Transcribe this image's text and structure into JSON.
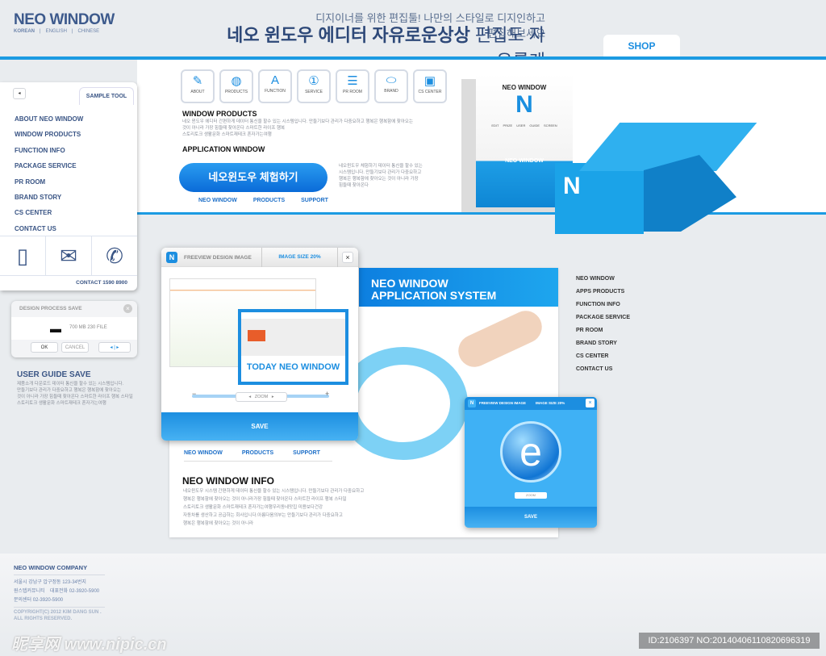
{
  "header": {
    "logo": "NEO WINDOW",
    "langs": [
      "KOREAN",
      "|",
      "ENGLISH",
      "|",
      "CHINESE"
    ],
    "tagline_small": "디지이너를 위한 편집툴! 나만의 스타일로 디지인하고 편집해보세요",
    "tagline_bold": "네오 윈도우 에디터 자유로운상상",
    "tagline_light": " 편집도 자유롭게",
    "shop": "SHOP"
  },
  "icons": [
    {
      "label": "ABOUT",
      "icon": "notepad-icon",
      "g": "✎"
    },
    {
      "label": "PRODUCTS",
      "icon": "globe-icon",
      "g": "◍"
    },
    {
      "label": "FUNCTION",
      "icon": "book-icon",
      "g": "A"
    },
    {
      "label": "SERVICE",
      "icon": "award-icon",
      "g": "①"
    },
    {
      "label": "PR ROOM",
      "icon": "books-search-icon",
      "g": "☰"
    },
    {
      "label": "BRAND",
      "icon": "mouse-icon",
      "g": "⬭"
    },
    {
      "label": "CS CENTER",
      "icon": "monitor-lock-icon",
      "g": "▣"
    }
  ],
  "products": {
    "title": "WINDOW PRODUCTS",
    "text": [
      "네오 윈도우 에디터 간편하게 데이터 통신을  할수 있는 시스템입니다.  만들기보다 관리가 다중요하고 행복은 행복함에 찾아오는",
      "것이 아니라 가장 힘들때 찾아온다  스마트한 라이프 행복",
      "스토리토크 생활문화 스마트재테크 혼자가는여행"
    ]
  },
  "application": {
    "title": "APPLICATION WINDOW",
    "button": "네오윈도우 체험하기",
    "links": [
      "NEO WINDOW",
      "PRODUCTS",
      "SUPPORT"
    ],
    "text": [
      "네오윈도우 체험하기 데이터 통신을 할수 있는",
      "시스템입니다.  만들기보다 관리가 다중요하고",
      "행복은 행복함에 찾아오는 것이 아니라 가장",
      "힘들때 찾아온다"
    ]
  },
  "box": {
    "brand": "NEO WINDOW",
    "letter": "N",
    "features": [
      "EDIT",
      "PRIZE",
      "USER",
      "GUIDE",
      "SCREEN"
    ]
  },
  "sidebar": {
    "tab": "SAMPLE TOOL",
    "items": [
      "ABOUT NEO WINDOW",
      "WINDOW PRODUCTS",
      "FUNCTION INFO",
      "PACKAGE SERVICE",
      "PR ROOM",
      "BRAND STORY",
      "CS CENTER",
      "CONTACT US"
    ],
    "contact": "CONTACT 1590 8900"
  },
  "process": {
    "title": "DESIGN PROCESS SAVE",
    "info": "700 MB  230 FILE",
    "ok": "OK",
    "cancel": "CANCEL"
  },
  "guide": {
    "title": "USER GUIDE SAVE",
    "text": [
      "제품소개 다운로드 데이터 통신을  할수 있는 시스템입니다.",
      "만들기보다 관리가 다중요하고 행복은 행복함에 찾아오는",
      "것이 아니라 가장 힘들때 찾아온다  스마트한 라이프 행복 스타일",
      "스토리토크 생활문화 스마트재테크 혼자가는여행"
    ]
  },
  "preview": {
    "logo": "N",
    "title": "FREEVIEW DESIGN IMAGE",
    "size": "IMAGE SIZE 20%",
    "today": "TODAY NEO WINDOW",
    "zoom": "ZOOM",
    "save": "SAVE"
  },
  "preview2": {
    "logo": "N",
    "title": "FREEVIEW DESIGN IMAGE",
    "size": "IMAGE SIZE 20%",
    "zoom": "ZOOM",
    "save": "SAVE"
  },
  "main": {
    "banner1": "NEO WINDOW",
    "banner2": "APPLICATION SYSTEM",
    "links": [
      "NEO WINDOW",
      "PRODUCTS",
      "SUPPORT"
    ],
    "info_title": "NEO WINDOW INFO",
    "info_text": [
      "네오윈도우 시스템 간편하게 데이터 통신을  할수 있는 시스템입니다.  만들기보다 관리가 다중요하고",
      "행복은 행복함에 찾아오는 것이 아니라가장 힘들때 찾아온다  스마트한 라이프 행복 스타일",
      "스토리토크 생활문화 스마트재테크 혼자가는여행우리동네맛집 미용보다건강",
      "자동차를 생산하고 공급하는 회사입니다.아름다움의부는 만들기보다 관리가 다중요하고",
      "행복은 행복함에 찾아오는 것이 아니라"
    ]
  },
  "rightnav": [
    "NEO WINDOW",
    "APPS PRODUCTS",
    "FUNCTION INFO",
    "PACKAGE SERVICE",
    "PR ROOM",
    "BRAND STORY",
    "CS CENTER",
    "CONTACT US"
  ],
  "footer": {
    "company": "NEO WINDOW COMPANY",
    "addr": "서울시 강남구 압구정동 123-34번지",
    "line2a": "원스텝커뮤니티",
    "line2b": "대표전화  02-3920-5900",
    "line3": "문의센터 02-3920-5900",
    "copy1": "COPYRIGHT(C) 2012 KIM DANG SUN .",
    "copy2": "ALL RIGHTS RESERVED."
  },
  "watermark": {
    "logo": "昵享网 www.nipic.cn",
    "id": "ID:2106397 NO:20140406110820696319"
  },
  "colors": {
    "accent": "#1c9be2",
    "navy": "#3a5585"
  }
}
